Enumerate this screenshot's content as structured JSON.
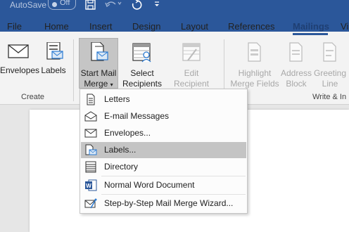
{
  "titlebar": {
    "autosave_label": "AutoSave",
    "autosave_state": "Off",
    "save_icon": "save-icon",
    "undo_icon": "undo-icon",
    "redo_icon": "redo-icon",
    "customize_icon": "customize-qat-icon"
  },
  "tabs": [
    {
      "label": "File"
    },
    {
      "label": "Home"
    },
    {
      "label": "Insert"
    },
    {
      "label": "Design"
    },
    {
      "label": "Layout"
    },
    {
      "label": "References"
    },
    {
      "label": "Mailings"
    },
    {
      "label": "Vi"
    }
  ],
  "active_tab": "Mailings",
  "ribbon": {
    "envelopes": "Envelopes",
    "labels": "Labels",
    "group_create": "Create",
    "start_mail_line1": "Start Mail",
    "start_mail_line2": "Merge",
    "select_line1": "Select",
    "select_line2": "Recipients",
    "edit_line1": "Edit",
    "edit_line2": "Recipient List",
    "highlight_line1": "Highlight",
    "highlight_line2": "Merge Fields",
    "address_line1": "Address",
    "address_line2": "Block",
    "greeting_line1": "Greeting",
    "greeting_line2": "Line",
    "group_write": "Write & In"
  },
  "menu": {
    "items": [
      {
        "label": "Letters",
        "icon": "letter-icon"
      },
      {
        "label": "E-mail Messages",
        "icon": "email-message-icon"
      },
      {
        "label": "Envelopes...",
        "icon": "envelope-icon"
      },
      {
        "label": "Labels...",
        "icon": "labels-icon",
        "highlighted": true
      },
      {
        "label": "Directory",
        "icon": "directory-icon"
      },
      {
        "label": "Normal Word Document",
        "icon": "word-document-icon"
      },
      {
        "label": "Step-by-Step Mail Merge Wizard...",
        "icon": "wizard-icon"
      }
    ]
  },
  "colors": {
    "brand": "#2b579a",
    "ribbon_bg": "#f3f3f3",
    "highlight": "#c4c4c4"
  }
}
